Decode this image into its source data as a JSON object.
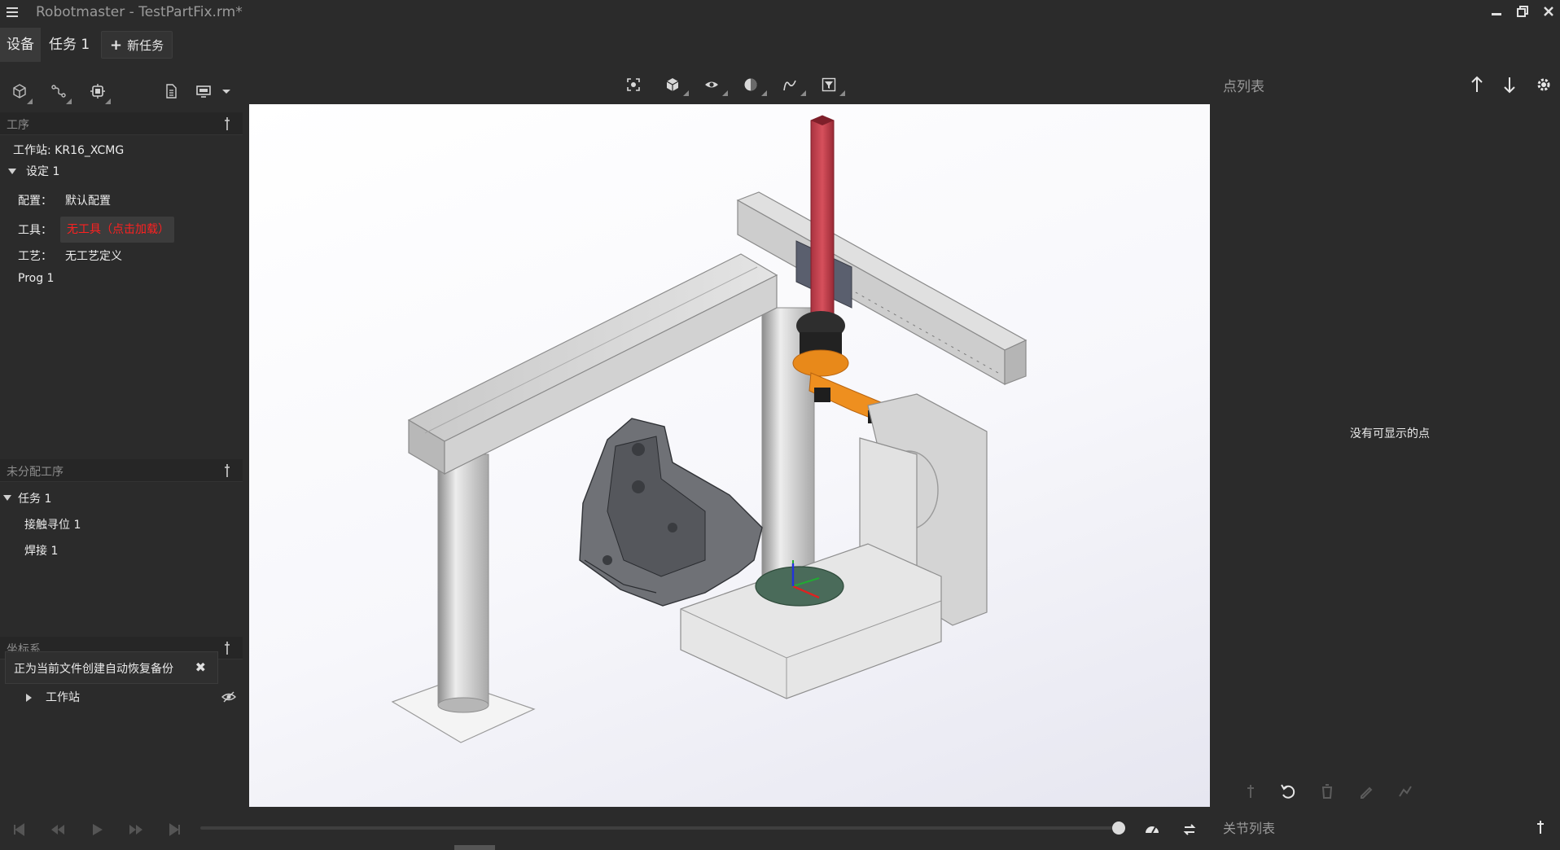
{
  "window": {
    "title": "Robotmaster - TestPartFix.rm*",
    "icons": [
      "menu-icon",
      "minimize-icon",
      "restore-icon",
      "close-icon"
    ]
  },
  "tabs": {
    "equipment": "设备",
    "task1": "任务 1",
    "new_task": "新任务"
  },
  "left_panel": {
    "toolbar_icons": [
      "cell-icon",
      "path-icon",
      "robot-icon",
      "document-icon",
      "display-icon",
      "dropdown-icon"
    ],
    "process_section": {
      "title": "工序",
      "workstation": "工作站: KR16_XCMG",
      "setup": "设定 1",
      "config_label": "配置：",
      "config_value": "默认配置",
      "tool_label": "工具：",
      "tool_value": "无工具（点击加载）",
      "process_label": "工艺：",
      "process_value": "无工艺定义",
      "program": "Prog 1"
    },
    "unassigned_section": {
      "title": "未分配工序",
      "task": "任务 1",
      "items": [
        "接触寻位 1",
        "焊接 1"
      ]
    },
    "coordinate_section": {
      "title": "坐标系",
      "workstation": "工作站"
    },
    "toast": {
      "message": "正为当前文件创建自动恢复备份"
    }
  },
  "viewport": {
    "toolbar_icons": [
      "fit-view-icon",
      "cube-view-icon",
      "eye-icon",
      "shading-icon",
      "curve-icon",
      "filter-icon"
    ]
  },
  "right_panel": {
    "title": "点列表",
    "empty_message": "没有可显示的点",
    "joint_list_title": "关节列表",
    "icons": [
      "arrow-up-icon",
      "arrow-down-icon",
      "settings-icon",
      "pin-icon",
      "undo-icon",
      "delete-icon",
      "edit-icon",
      "graph-icon"
    ]
  },
  "player": {
    "icons": [
      "skip-start-icon",
      "step-back-icon",
      "play-icon",
      "step-forward-icon",
      "skip-end-icon",
      "speed-icon",
      "loop-icon"
    ],
    "progress": 1.0
  }
}
